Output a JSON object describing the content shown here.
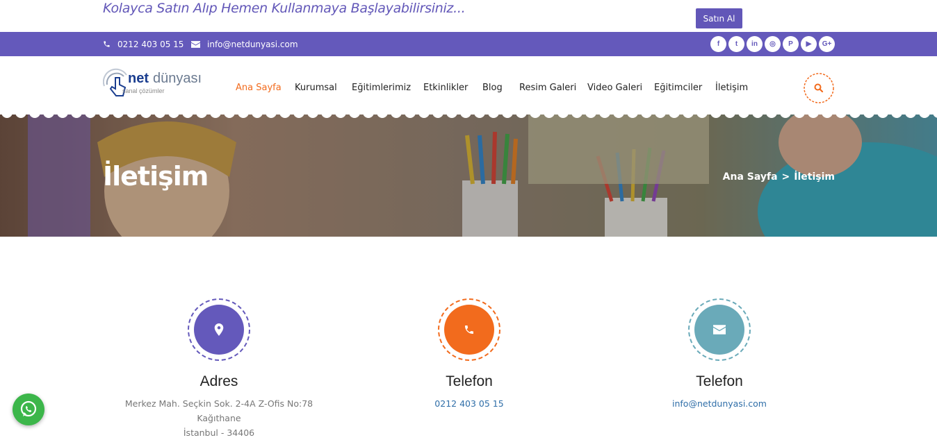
{
  "promo": {
    "text": "Kolayca Satın Alıp Hemen Kullanmaya Başlayabilirsiniz...",
    "buy_label": "Satın Al"
  },
  "topbar": {
    "phone": "0212 403 05 15",
    "email": "info@netdunyasi.com",
    "social": [
      {
        "icon": "facebook-icon",
        "glyph": "f"
      },
      {
        "icon": "twitter-icon",
        "glyph": "t"
      },
      {
        "icon": "linkedin-icon",
        "glyph": "in"
      },
      {
        "icon": "instagram-icon",
        "glyph": "◎"
      },
      {
        "icon": "pinterest-icon",
        "glyph": "P"
      },
      {
        "icon": "youtube-icon",
        "glyph": "▶"
      },
      {
        "icon": "google-plus-icon",
        "glyph": "G+"
      }
    ]
  },
  "logo": {
    "brand_bold": "net",
    "brand_light": "dünyası",
    "tagline": "sanal çözümler"
  },
  "nav": {
    "items": [
      "Ana Sayfa",
      "Kurumsal",
      "Eğitimlerimiz",
      "Etkinlikler",
      "Blog",
      "Resim Galeri",
      "Video Galeri",
      "Eğitimciler",
      "İletişim"
    ],
    "active_index": 0
  },
  "hero": {
    "title": "İletişim",
    "crumb_home": "Ana Sayfa",
    "crumb_sep": ">",
    "crumb_current": "İletişim"
  },
  "contacts": [
    {
      "title": "Adres",
      "text_line1": "Merkez Mah. Seçkin Sok. 2-4A Z-Ofis No:78 Kağıthane",
      "text_line2": "İstanbul - 34406",
      "icon": "map-marker-icon"
    },
    {
      "title": "Telefon",
      "text_line1": "0212 403 05 15",
      "icon": "phone-icon"
    },
    {
      "title": "Telefon",
      "text_line1": "info@netdunyasi.com",
      "icon": "envelope-icon"
    }
  ],
  "colors": {
    "purple": "#6459bb",
    "orange": "#f26b1d",
    "teal": "#6aaab9",
    "whatsapp": "#3cb64a"
  }
}
